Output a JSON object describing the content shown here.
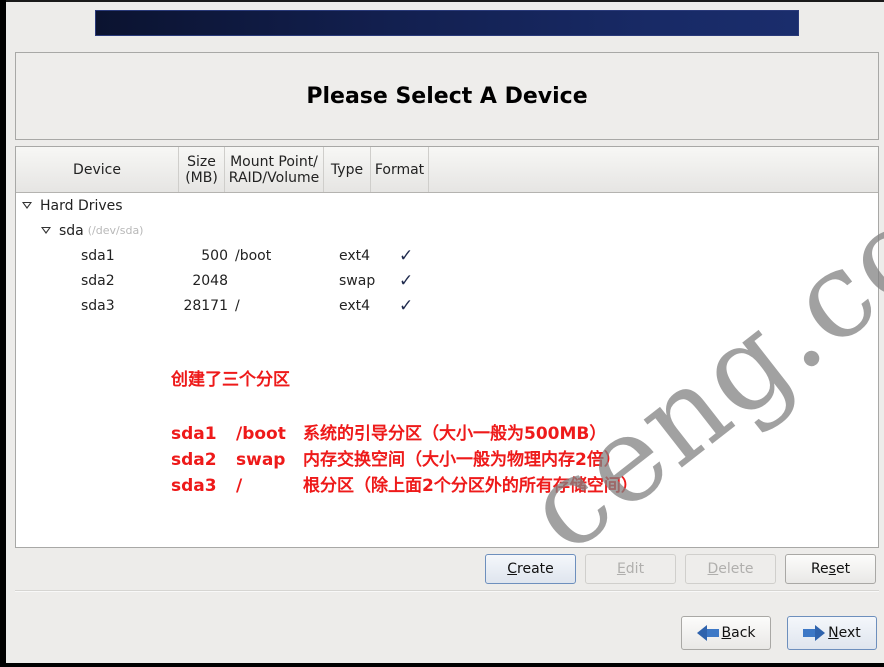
{
  "page": {
    "title": "Please Select A Device"
  },
  "table": {
    "columns": [
      {
        "label": "Device"
      },
      {
        "label": "Size\n(MB)"
      },
      {
        "label": "Mount Point/\nRAID/Volume"
      },
      {
        "label": "Type"
      },
      {
        "label": "Format"
      }
    ],
    "group": {
      "label": "Hard Drives",
      "expanded": true
    },
    "disk": {
      "name": "sda",
      "path": "(/dev/sda)",
      "expanded": true
    },
    "partitions": [
      {
        "device": "sda1",
        "size": "500",
        "mount": "/boot",
        "type": "ext4",
        "format": "✓"
      },
      {
        "device": "sda2",
        "size": "2048",
        "mount": "",
        "type": "swap",
        "format": "✓"
      },
      {
        "device": "sda3",
        "size": "28171",
        "mount": "/",
        "type": "ext4",
        "format": "✓"
      }
    ]
  },
  "annotation": {
    "heading": "创建了三个分区",
    "lines": [
      {
        "dev": "sda1",
        "mount": "/boot",
        "desc": "系统的引导分区（大小一般为500MB）"
      },
      {
        "dev": "sda2",
        "mount": "swap",
        "desc": "内存交换空间（大小一般为物理内存2倍）"
      },
      {
        "dev": "sda3",
        "mount": "/",
        "desc": "根分区（除上面2个分区外的所有存储空间）"
      }
    ],
    "color": "#ee1a1a"
  },
  "buttons": {
    "create": {
      "pre": "",
      "mnemonic": "C",
      "post": "reate"
    },
    "edit": {
      "pre": "",
      "mnemonic": "E",
      "post": "dit"
    },
    "delete": {
      "pre": "",
      "mnemonic": "D",
      "post": "elete"
    },
    "reset": {
      "pre": "Re",
      "mnemonic": "s",
      "post": "et"
    },
    "back": {
      "pre": "",
      "mnemonic": "B",
      "post": "ack"
    },
    "next": {
      "pre": "",
      "mnemonic": "N",
      "post": "ext"
    }
  },
  "watermark": {
    "text": "ceng.com"
  }
}
